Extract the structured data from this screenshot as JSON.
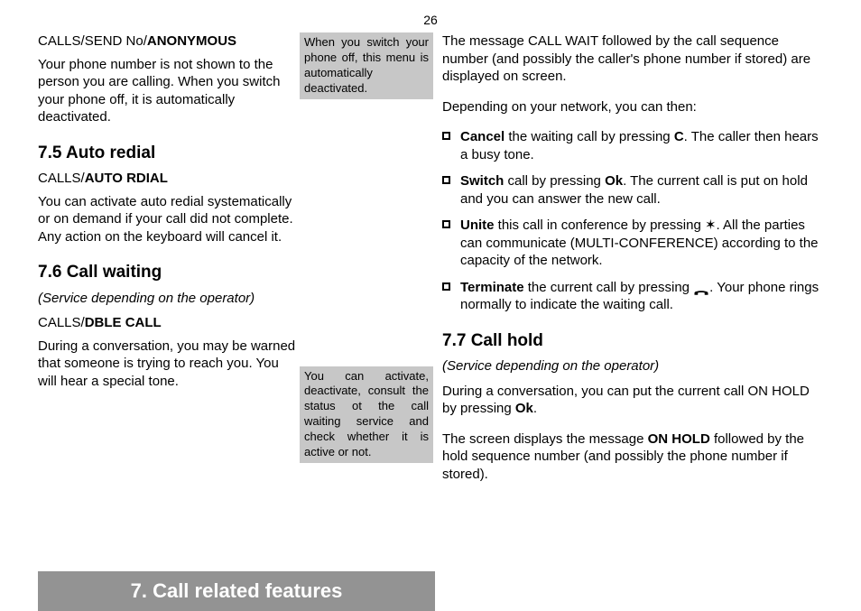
{
  "pageNumber": "26",
  "chapterBanner": "7. Call related features",
  "left": {
    "anon": {
      "path_pre": "CALLS/SEND No/",
      "path_bold": "ANONYMOUS",
      "body": "Your phone number is not shown to the person you are calling. When you switch your phone off, it is automatically deactivated."
    },
    "auto": {
      "heading": "7.5 Auto redial",
      "path_pre": "CALLS/",
      "path_bold": "AUTO RDIAL",
      "body": "You can activate auto redial systematically or on demand if your call did not complete. Any action on the keyboard will cancel it."
    },
    "wait": {
      "heading": "7.6 Call waiting",
      "service": "(Service depending on the operator)",
      "path_pre": "CALLS/",
      "path_bold": "DBLE CALL",
      "body": "During a conversation, you may be warned that someone is trying to reach you. You will hear a special tone."
    }
  },
  "mid": {
    "box1": "When you switch your phone off, this menu is automatically deactivated.",
    "box2": "You can activate, deactivate, consult the status ot the call waiting service and check whether it is active or not."
  },
  "right": {
    "intro": "The message CALL WAIT followed by the call sequence number (and possibly the caller's phone number if stored) are displayed on screen.",
    "depend": "Depending on your network, you can then:",
    "bullets": {
      "cancel": {
        "b": "Cancel",
        "t1": " the waiting call by pressing ",
        "k": "C",
        "t2": ". The caller then hears a busy tone."
      },
      "switch": {
        "b": "Switch",
        "t1": "  call by pressing ",
        "k": "Ok",
        "t2": ". The current call is put on hold and you can answer the new call."
      },
      "unite": {
        "b": "Unite",
        "t1": " this call in conference by pressing ",
        "sym": "✶",
        "t2": ". All the parties can communicate (MULTI-CONFERENCE) according to the capacity of the network."
      },
      "term": {
        "b": "Terminate",
        "t1": " the current call by pressing ",
        "t2": ". Your phone rings normally to indicate the waiting call."
      }
    },
    "hold": {
      "heading": "7.7 Call hold",
      "service": "(Service depending on the operator)",
      "p1a": "During a conversation, you can put the current call ON HOLD by pressing ",
      "p1k": "Ok",
      "p1b": ".",
      "p2a": "The screen displays the message ",
      "p2k": "ON HOLD",
      "p2b": " followed by the hold sequence number (and possibly the phone number if stored)."
    }
  }
}
